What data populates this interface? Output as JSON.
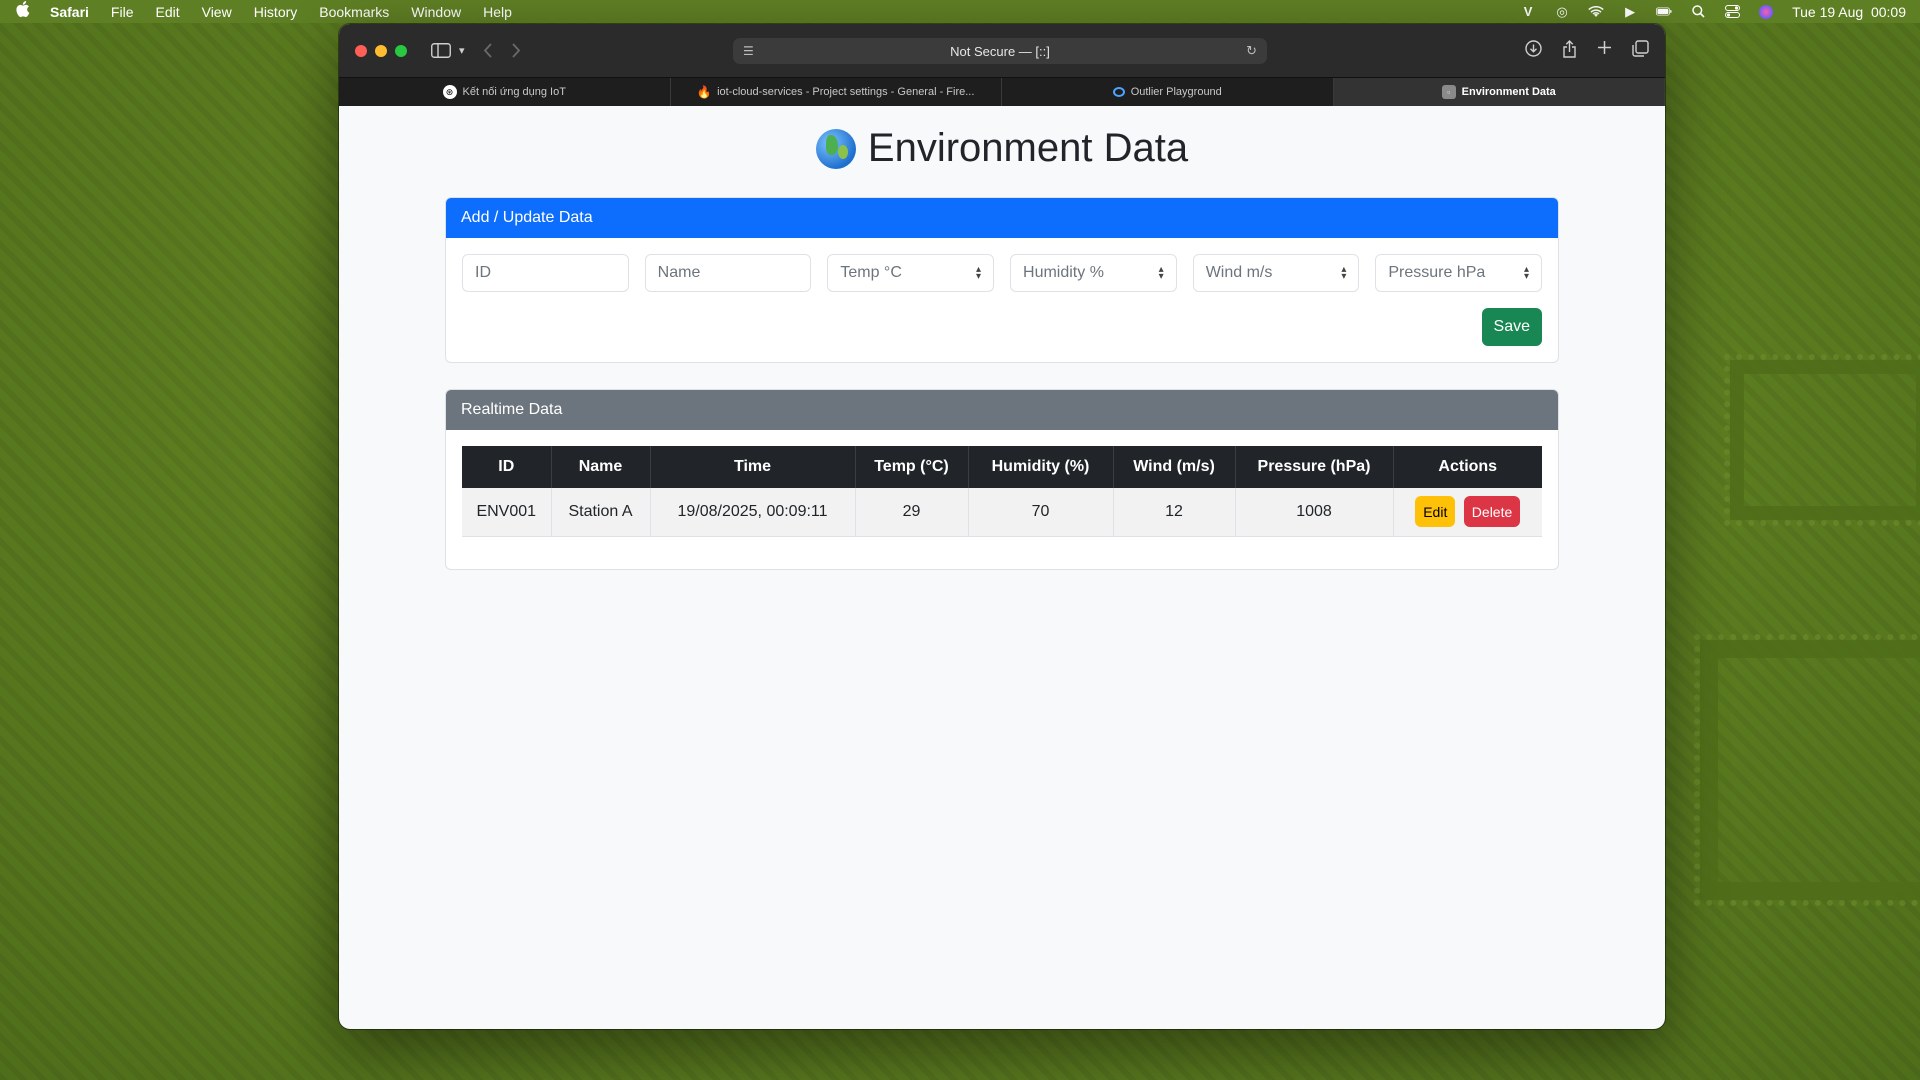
{
  "menubar": {
    "app": "Safari",
    "items": [
      "File",
      "Edit",
      "View",
      "History",
      "Bookmarks",
      "Window",
      "Help"
    ],
    "clock": "Tue 19 Aug  00:09"
  },
  "browser": {
    "address": "Not Secure — [::]",
    "tabs": [
      {
        "label": "Kết nối ứng dụng IoT",
        "icon": "openai-icon"
      },
      {
        "label": "iot-cloud-services - Project settings - General - Fire...",
        "icon": "firebase-icon"
      },
      {
        "label": "Outlier Playground",
        "icon": "outlier-icon"
      },
      {
        "label": "Environment Data",
        "icon": "page-icon",
        "active": true
      }
    ]
  },
  "page": {
    "title": "Environment Data"
  },
  "form": {
    "header": "Add / Update Data",
    "id_placeholder": "ID",
    "name_placeholder": "Name",
    "temp_placeholder": "Temp °C",
    "humidity_placeholder": "Humidity %",
    "wind_placeholder": "Wind m/s",
    "pressure_placeholder": "Pressure hPa",
    "save_label": "Save"
  },
  "realtime": {
    "header": "Realtime Data",
    "columns": [
      "ID",
      "Name",
      "Time",
      "Temp (°C)",
      "Humidity (%)",
      "Wind (m/s)",
      "Pressure (hPa)",
      "Actions"
    ],
    "rows": [
      {
        "id": "ENV001",
        "name": "Station A",
        "time": "19/08/2025, 00:09:11",
        "temp": "29",
        "humidity": "70",
        "wind": "12",
        "pressure": "1008"
      }
    ],
    "edit_label": "Edit",
    "delete_label": "Delete"
  },
  "colors": {
    "primary": "#0d6efd",
    "secondary": "#6c757d",
    "success": "#198754",
    "warning": "#ffc107",
    "danger": "#dc3545"
  }
}
